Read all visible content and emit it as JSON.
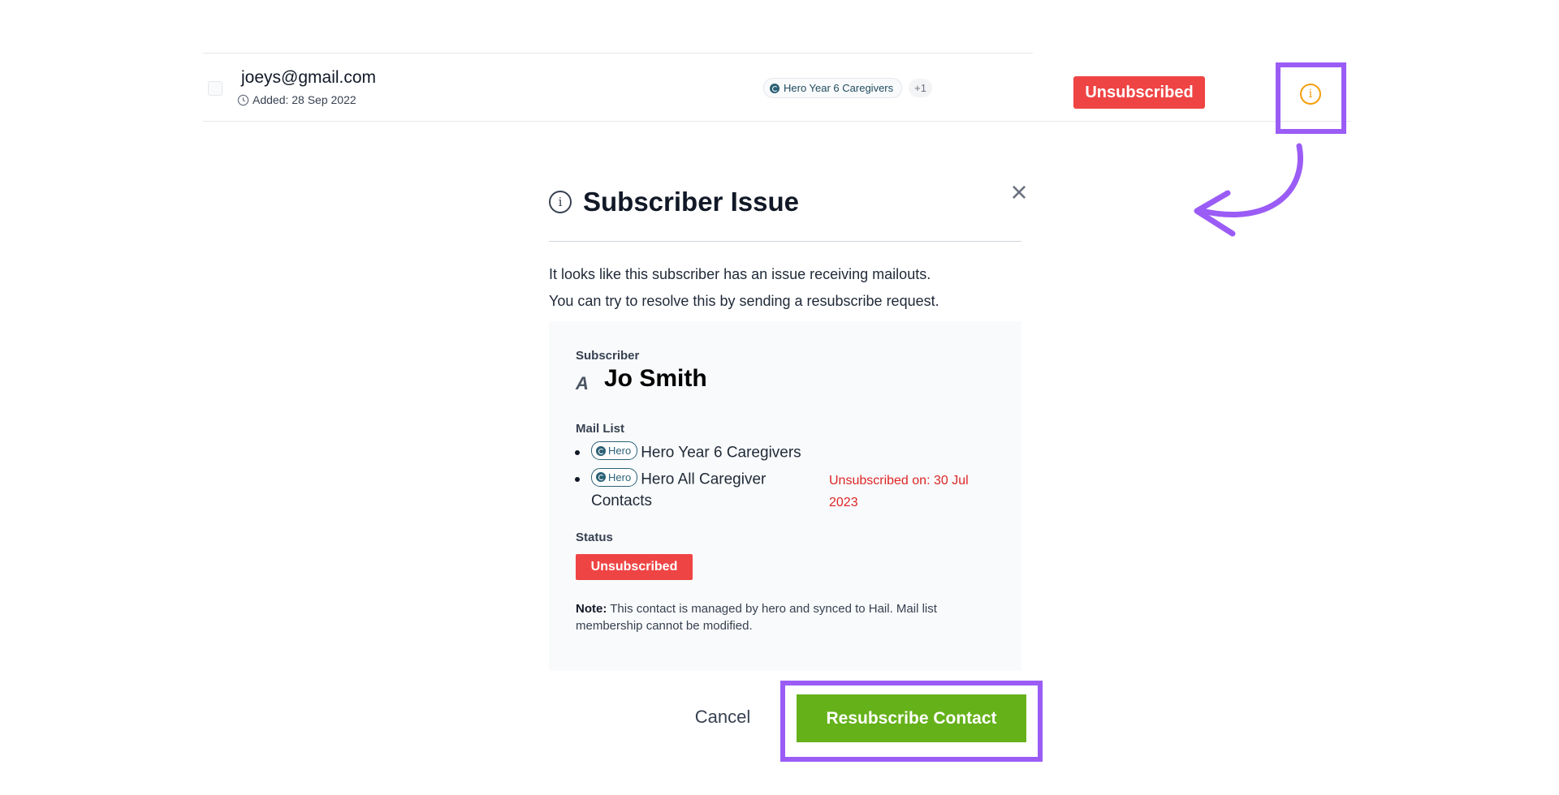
{
  "contact_row": {
    "email": "joeys@gmail.com",
    "added": "Added: 28 Sep 2022",
    "tag_label": "Hero Year 6 Caregivers",
    "tag_more": "+1",
    "status": "Unsubscribed"
  },
  "modal": {
    "title": "Subscriber Issue",
    "description_line1": "It looks like this subscriber has an issue receiving mailouts.",
    "description_line2": "You can try to resolve this by sending a resubscribe request.",
    "subscriber_label": "Subscriber",
    "subscriber_initial": "A",
    "subscriber_name": "Jo Smith",
    "mail_list_label": "Mail List",
    "mail_lists": [
      {
        "badge": "Hero",
        "name": "Hero Year 6 Caregivers",
        "note": ""
      },
      {
        "badge": "Hero",
        "name": "Hero All Caregiver Contacts",
        "note": "Unsubscribed on: 30 Jul 2023"
      }
    ],
    "status_label": "Status",
    "status_value": "Unsubscribed",
    "note_bold": "Note:",
    "note_text": "This contact is managed by hero and synced to Hail. Mail list membership cannot be modified.",
    "cancel_label": "Cancel",
    "resubscribe_label": "Resubscribe Contact"
  },
  "colors": {
    "highlight": "#9b5cf6",
    "unsubscribed_red": "#ef4444",
    "resubscribe_green": "#65b11a",
    "info_orange": "#f59e0b"
  },
  "icons": [
    "clock-icon",
    "hero-icon",
    "info-icon",
    "close-icon",
    "arrow-annotation"
  ]
}
